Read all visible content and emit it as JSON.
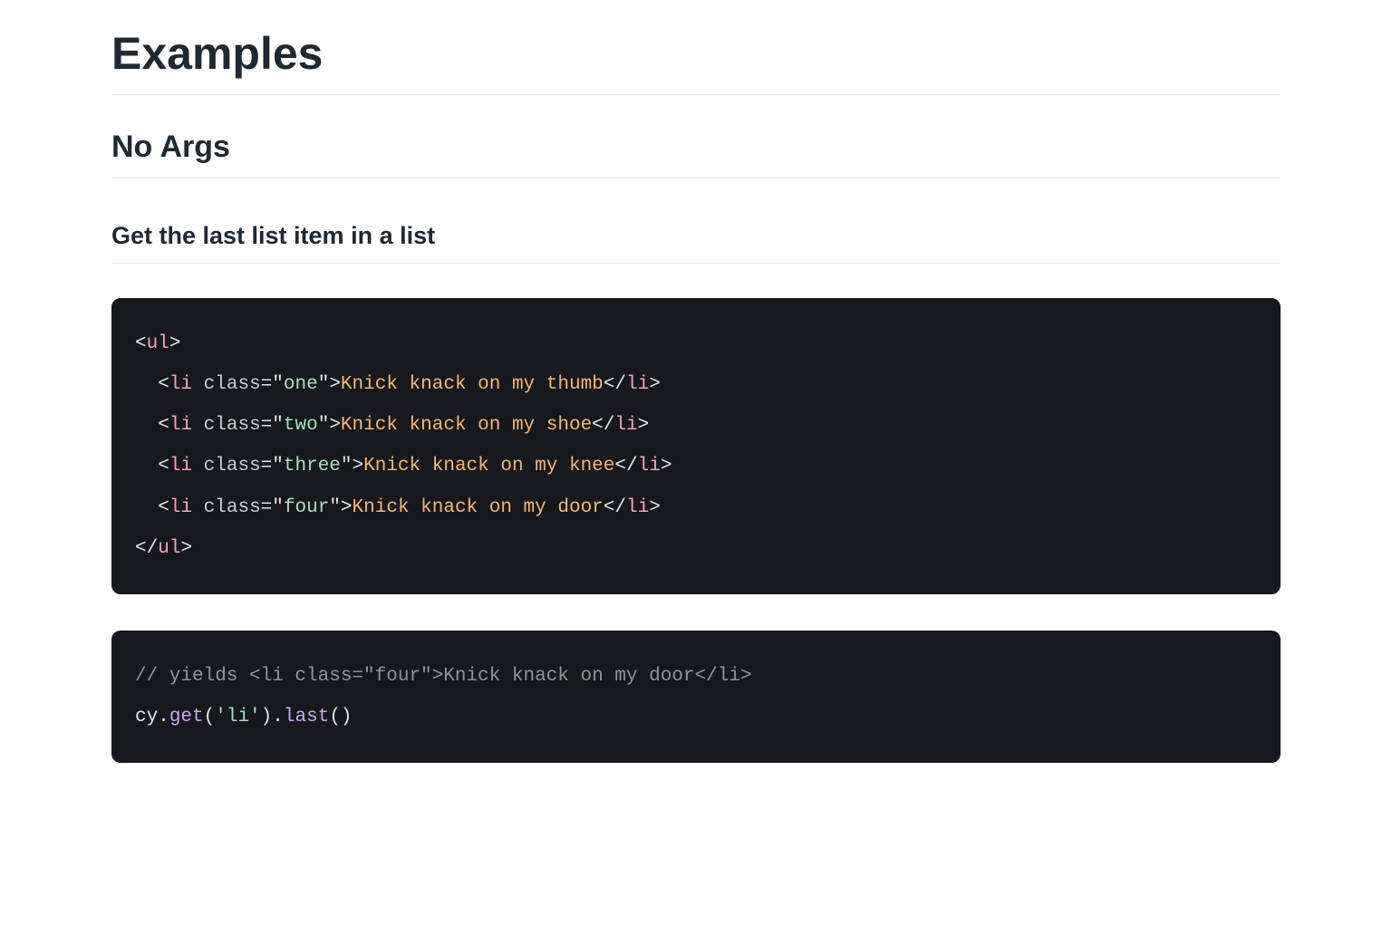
{
  "headings": {
    "h1": "Examples",
    "h2": "No Args",
    "h3": "Get the last list item in a list"
  },
  "code1": {
    "ul_open_lt": "<",
    "ul_open_name": "ul",
    "ul_open_gt": ">",
    "items": [
      {
        "lt": "<",
        "tag": "li",
        "sp": " ",
        "attr": "class",
        "eq": "=",
        "q1": "\"",
        "val": "one",
        "q2": "\"",
        "gt": ">",
        "text": "Knick knack on my thumb",
        "clt": "</",
        "ctag": "li",
        "cgt": ">"
      },
      {
        "lt": "<",
        "tag": "li",
        "sp": " ",
        "attr": "class",
        "eq": "=",
        "q1": "\"",
        "val": "two",
        "q2": "\"",
        "gt": ">",
        "text": "Knick knack on my shoe",
        "clt": "</",
        "ctag": "li",
        "cgt": ">"
      },
      {
        "lt": "<",
        "tag": "li",
        "sp": " ",
        "attr": "class",
        "eq": "=",
        "q1": "\"",
        "val": "three",
        "q2": "\"",
        "gt": ">",
        "text": "Knick knack on my knee",
        "clt": "</",
        "ctag": "li",
        "cgt": ">"
      },
      {
        "lt": "<",
        "tag": "li",
        "sp": " ",
        "attr": "class",
        "eq": "=",
        "q1": "\"",
        "val": "four",
        "q2": "\"",
        "gt": ">",
        "text": "Knick knack on my door",
        "clt": "</",
        "ctag": "li",
        "cgt": ">"
      }
    ],
    "ul_close_lt": "</",
    "ul_close_name": "ul",
    "ul_close_gt": ">"
  },
  "code2": {
    "comment": "// yields <li class=\"four\">Knick knack on my door</li>",
    "cy": "cy",
    "dot1": ".",
    "get": "get",
    "lp1": "(",
    "arg": "'li'",
    "rp1": ")",
    "dot2": ".",
    "last": "last",
    "lp2": "(",
    "rp2": ")"
  }
}
